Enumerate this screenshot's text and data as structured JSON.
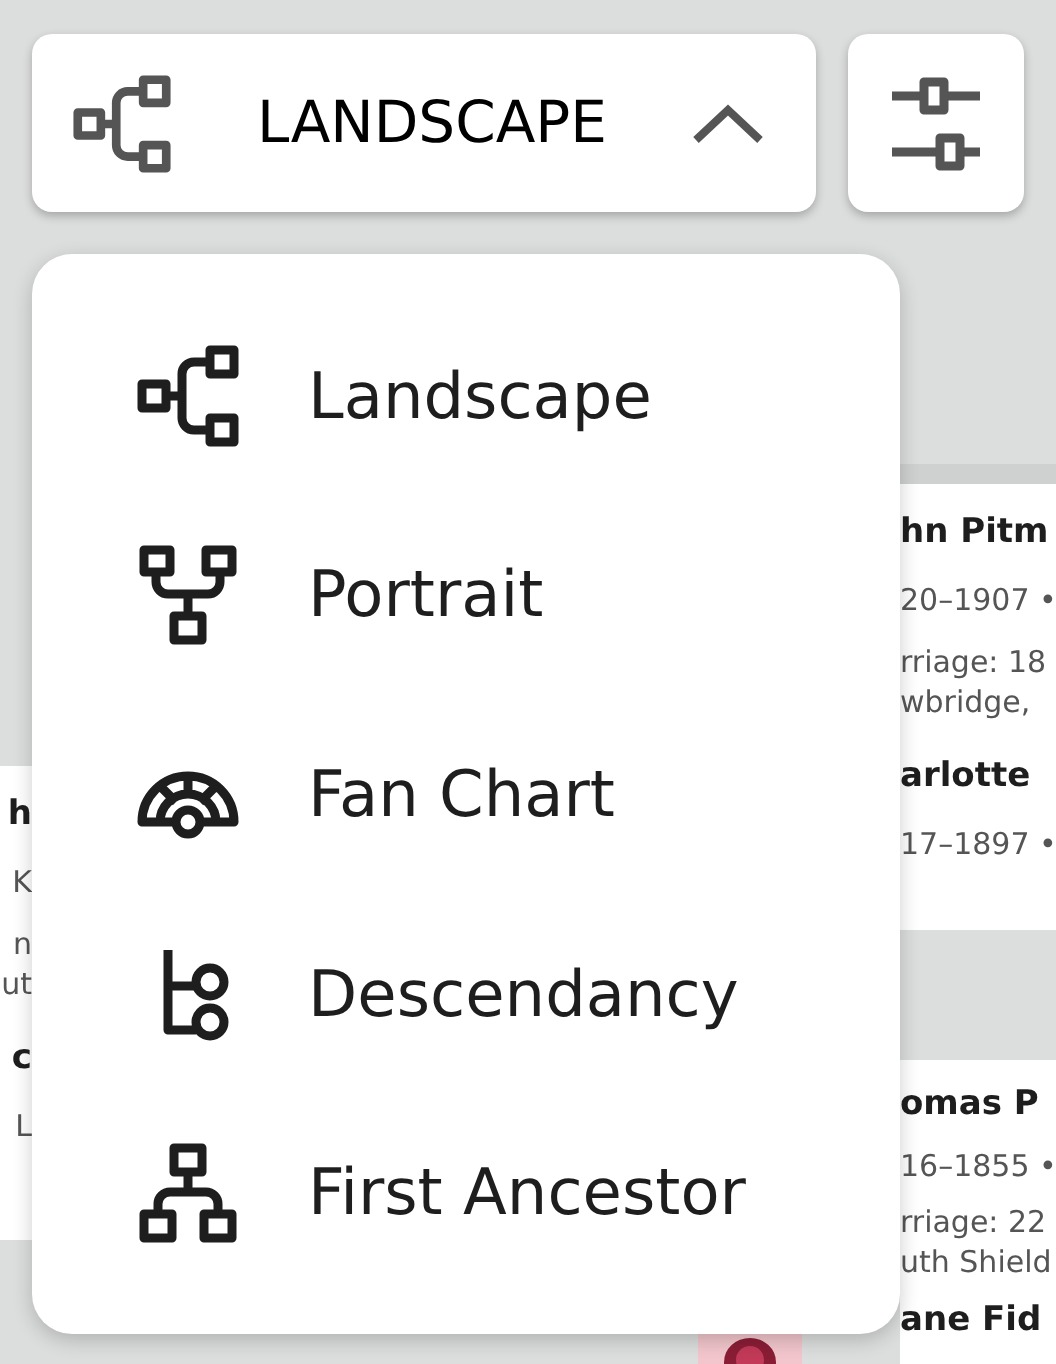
{
  "view_button": {
    "label": "LANDSCAPE",
    "kind": "landscape",
    "expanded": true
  },
  "settings_button": {
    "kind": "sliders"
  },
  "menu": {
    "items": [
      {
        "label": "Landscape",
        "kind": "landscape"
      },
      {
        "label": "Portrait",
        "kind": "portrait"
      },
      {
        "label": "Fan Chart",
        "kind": "fan"
      },
      {
        "label": "Descendancy",
        "kind": "descendancy"
      },
      {
        "label": "First Ancestor",
        "kind": "ancestor"
      }
    ]
  },
  "tree_cards": [
    {
      "lines": [
        {
          "text": "h",
          "kind": "name"
        },
        {
          "text": "K",
          "kind": "detail"
        },
        {
          "text": "n",
          "kind": "detail"
        },
        {
          "text": "ut",
          "kind": "detail2"
        },
        {
          "text": "c",
          "kind": "name"
        },
        {
          "text": "L",
          "kind": "detail"
        }
      ]
    },
    {
      "lines": [
        {
          "text": "hn Pitm",
          "kind": "name"
        },
        {
          "text": "20–1907 •",
          "kind": "detail"
        },
        {
          "text": "rriage: 18",
          "kind": "detail"
        },
        {
          "text": "wbridge,",
          "kind": "detail2"
        },
        {
          "text": "arlotte",
          "kind": "name"
        },
        {
          "text": "17–1897 •",
          "kind": "detail"
        }
      ]
    },
    {
      "lines": [
        {
          "text": "omas P",
          "kind": "name"
        },
        {
          "text": "16–1855 •",
          "kind": "detail"
        },
        {
          "text": "rriage: 22",
          "kind": "detail"
        },
        {
          "text": "uth Shield",
          "kind": "detail2"
        },
        {
          "text": "ane Fid",
          "kind": "name"
        }
      ]
    }
  ]
}
